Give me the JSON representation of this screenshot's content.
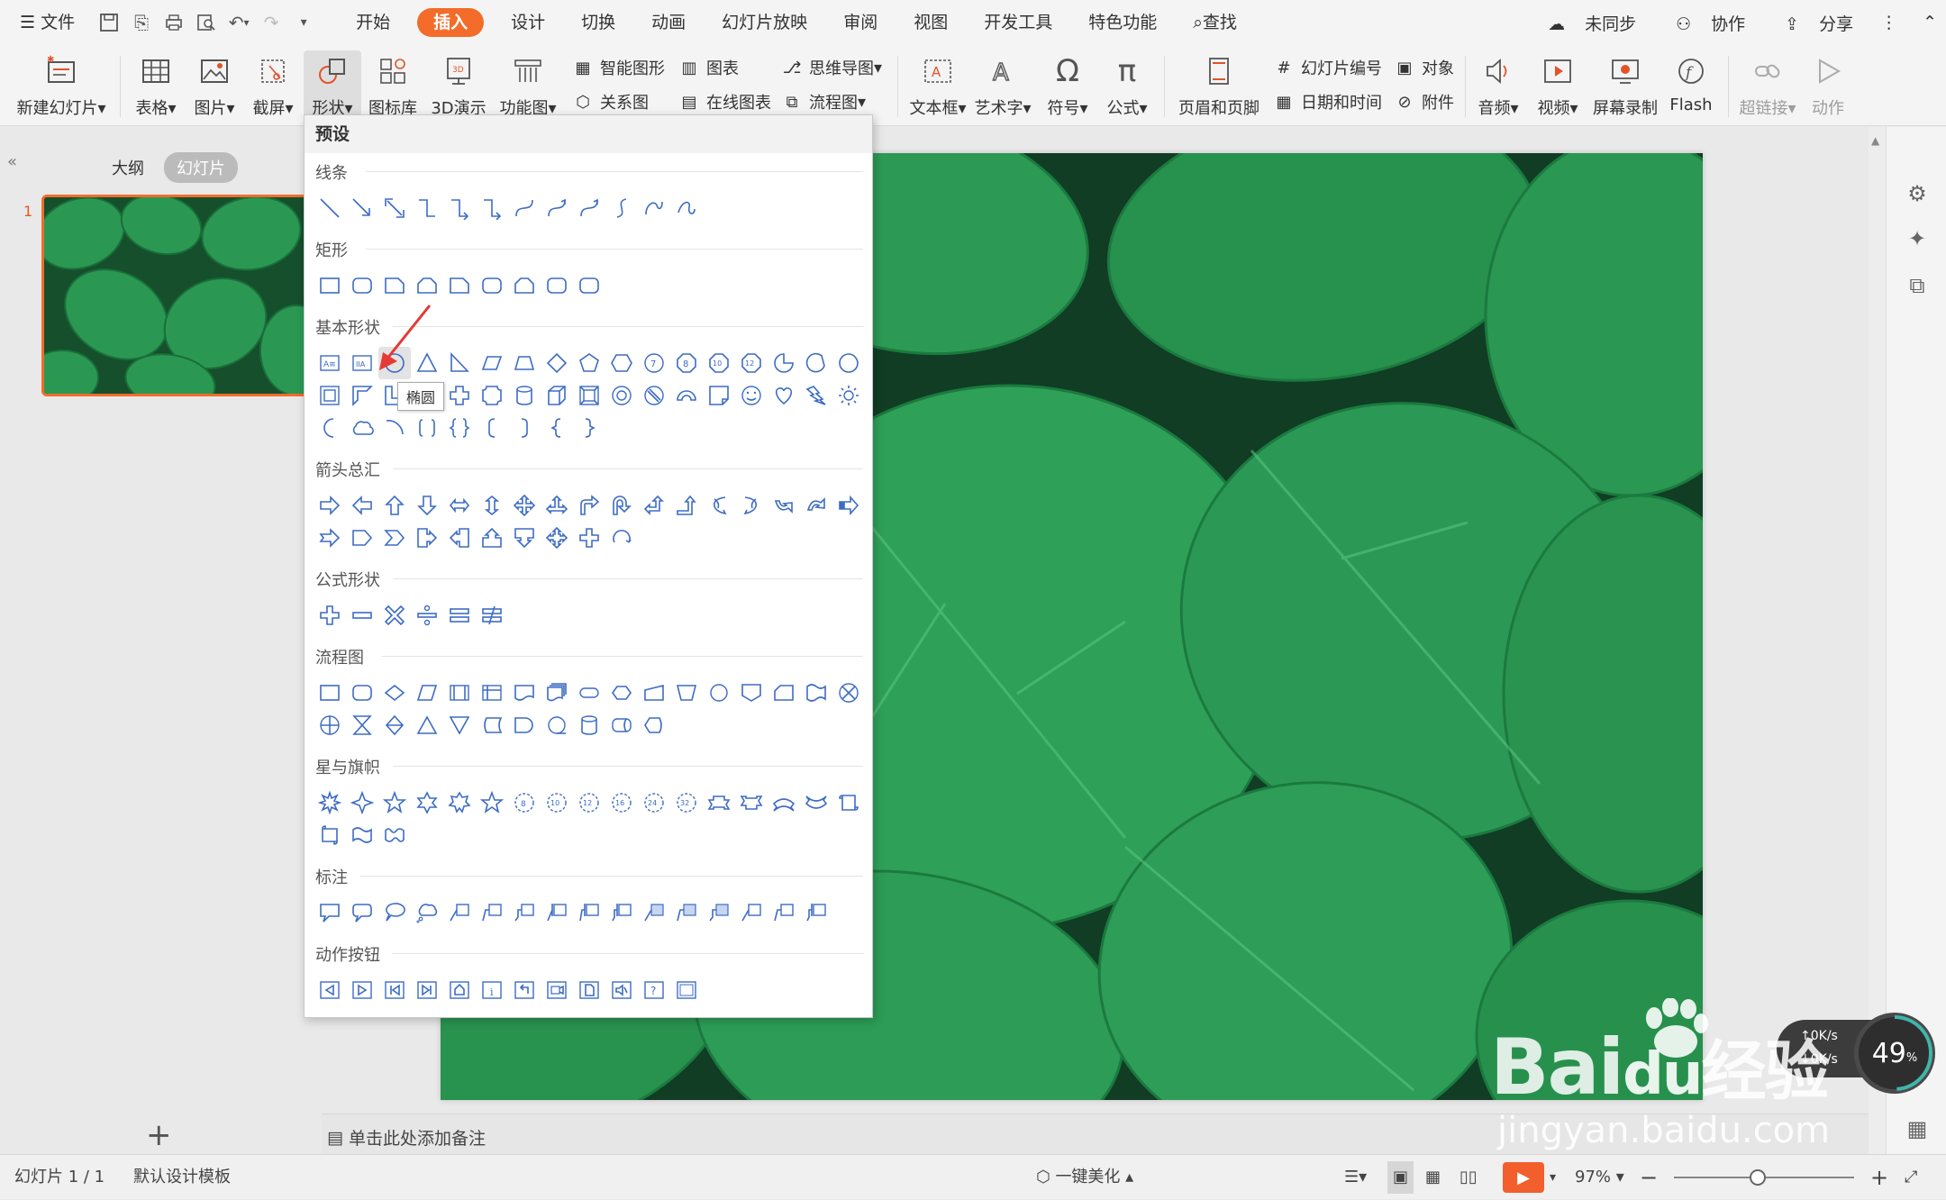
{
  "menubar": {
    "file": "文件",
    "tabs": [
      "开始",
      "插入",
      "设计",
      "切换",
      "动画",
      "幻灯片放映",
      "审阅",
      "视图",
      "开发工具",
      "特色功能"
    ],
    "active_tab": "插入",
    "search": "查找",
    "sync": "未同步",
    "collab": "协作",
    "share": "分享"
  },
  "ribbon": {
    "new_slide": "新建幻灯片",
    "table": "表格",
    "picture": "图片",
    "screenshot": "截屏",
    "shapes": "形状",
    "icon_lib": "图标库",
    "demo3d": "3D演示",
    "func_chart": "功能图",
    "smart_art": "智能图形",
    "chart": "图表",
    "mindmap": "思维导图",
    "relation": "关系图",
    "online_chart": "在线图表",
    "flowchart": "流程图",
    "textbox": "文本框",
    "wordart": "艺术字",
    "symbol": "符号",
    "formula": "公式",
    "header_footer": "页眉和页脚",
    "slide_no": "幻灯片编号",
    "object": "对象",
    "datetime": "日期和时间",
    "attachment": "附件",
    "audio": "音频",
    "video": "视频",
    "screen_record": "屏幕录制",
    "flash": "Flash",
    "hyperlink": "超链接",
    "action": "动作"
  },
  "left_panel": {
    "outline_tab": "大纲",
    "slides_tab": "幻灯片",
    "slide_number": "1"
  },
  "dropdown": {
    "header": "预设",
    "sections": [
      {
        "title": "线条"
      },
      {
        "title": "矩形"
      },
      {
        "title": "基本形状"
      },
      {
        "title": "箭头总汇"
      },
      {
        "title": "公式形状"
      },
      {
        "title": "流程图"
      },
      {
        "title": "星与旗帜"
      },
      {
        "title": "标注"
      },
      {
        "title": "动作按钮"
      }
    ],
    "tooltip": "椭圆"
  },
  "notes": {
    "placeholder": "单击此处添加备注"
  },
  "statusbar": {
    "slide_info": "幻灯片 1 / 1",
    "template": "默认设计模板",
    "beautify": "一键美化",
    "zoom": "97%"
  },
  "widget": {
    "percent": "49",
    "unit": "%",
    "speed_up": "0K/s",
    "speed_down": "0K/s"
  },
  "watermark": {
    "brand": "Bai",
    "brand2": "du",
    "brand3": "经验",
    "url": "jingyan.baidu.com"
  },
  "colors": {
    "accent": "#f36c2a",
    "shape_stroke": "#3d6cc4",
    "leaf": "#1f8a46"
  }
}
